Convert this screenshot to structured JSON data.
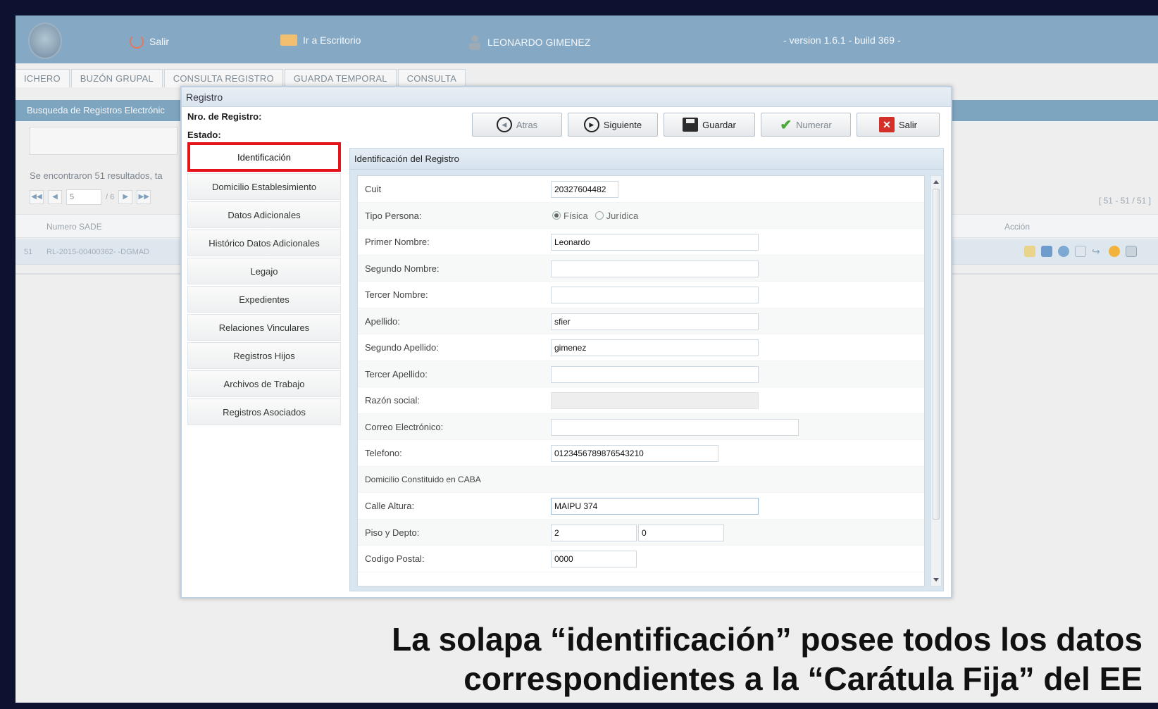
{
  "topbar": {
    "exit_label": "Salir",
    "desktop_label": "Ir a Escritorio",
    "user_name": "LEONARDO GIMENEZ",
    "version": "- version 1.6.1 - build 369 -"
  },
  "tabs": [
    "ICHERO",
    "BUZÓN GRUPAL",
    "CONSULTA REGISTRO",
    "GUARDA TEMPORAL",
    "CONSULTA"
  ],
  "background": {
    "panel_title": "Busqueda de Registros Electrónic",
    "results_text": "Se encontraron 51 resultados, ta",
    "page_value": "5",
    "page_of": "/ 6",
    "range": "[ 51 - 51 / 51 ]",
    "col_numero": "Numero SADE",
    "col_accion": "Acción",
    "row_index": "51",
    "row_numero": "RL-2015-00400362- -DGMAD"
  },
  "dialog": {
    "title": "Registro",
    "nro_label": "Nro. de Registro:",
    "estado_label": "Estado:",
    "toolbar": {
      "atras": "Atras",
      "siguiente": "Siguiente",
      "guardar": "Guardar",
      "numerar": "Numerar",
      "salir": "Salir"
    },
    "menu": [
      "Identificación",
      "Domicilio Establesimiento",
      "Datos Adicionales",
      "Histórico Datos Adicionales",
      "Legajo",
      "Expedientes",
      "Relaciones Vinculares",
      "Registros Hijos",
      "Archivos de Trabajo",
      "Registros Asociados"
    ],
    "form_title": "Identificación del Registro",
    "fields": {
      "cuit_label": "Cuit",
      "cuit_value": "20327604482",
      "tipo_label": "Tipo Persona:",
      "tipo_fisica": "Física",
      "tipo_juridica": "Jurídica",
      "primer_nombre_label": "Primer Nombre:",
      "primer_nombre_value": "Leonardo",
      "segundo_nombre_label": "Segundo Nombre:",
      "segundo_nombre_value": "",
      "tercer_nombre_label": "Tercer Nombre:",
      "tercer_nombre_value": "",
      "apellido_label": "Apellido:",
      "apellido_value": "sfier",
      "segundo_apellido_label": "Segundo Apellido:",
      "segundo_apellido_value": "gimenez",
      "tercer_apellido_label": "Tercer Apellido:",
      "tercer_apellido_value": "",
      "razon_label": "Razón social:",
      "razon_value": "",
      "correo_label": "Correo Electrónico:",
      "correo_value": "",
      "telefono_label": "Telefono:",
      "telefono_value": "01234567898765432​10",
      "domicilio_label": "Domicilio Constituido en CABA",
      "calle_label": "Calle Altura:",
      "calle_value": "MAIPU 374",
      "piso_label": "Piso y Depto:",
      "piso_value": "2",
      "depto_value": "0",
      "cp_label": "Codigo Postal:",
      "cp_value": "0000"
    }
  },
  "caption": {
    "line1": "La solapa “identificación” posee todos los datos",
    "line2": "correspondientes a la “Carátula Fija” del EE"
  },
  "colors": {
    "header_bg": "#85a9c4",
    "highlight_border": "#e3141a",
    "frame_bg": "#0c1230"
  }
}
